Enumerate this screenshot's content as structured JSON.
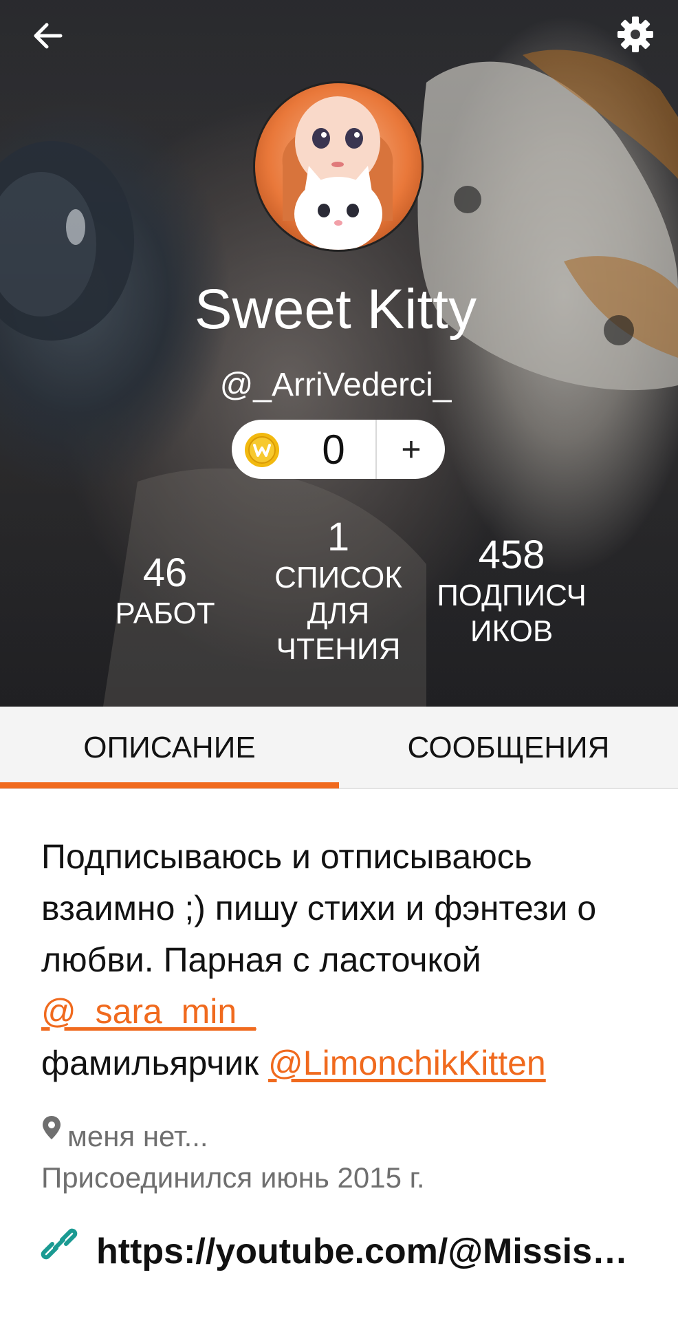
{
  "profile": {
    "name": "Sweet Kitty",
    "username": "@_ArriVederci_",
    "coins": "0",
    "add_coins_label": "+"
  },
  "stats": [
    {
      "value": "46",
      "label": "РАБОТ"
    },
    {
      "value": "1",
      "label_lines": [
        "СПИСОК",
        "ДЛЯ",
        "ЧТЕНИЯ"
      ]
    },
    {
      "value": "458",
      "label_lines": [
        "ПОДПИСЧ",
        "ИКОВ"
      ]
    }
  ],
  "tabs": [
    {
      "label": "ОПИСАНИЕ",
      "active": true
    },
    {
      "label": "СООБЩЕНИЯ",
      "active": false
    }
  ],
  "about": {
    "bio_text_1": "Подписываюсь и отписываюсь взаимно ;) пишу стихи и фэнтези о любви. Парная с ласточкой",
    "mention_1": "@_sara_min_",
    "bio_text_2": "фамильярчик",
    "mention_2": "@LimonchikKitten",
    "location": "меня нет...",
    "joined": "Присоединился июнь 2015 г.",
    "website": "https://youtube.com/@Missis_…"
  },
  "colors": {
    "accent": "#f06a1e",
    "link_icon": "#1a9a92",
    "coin": "#f2b90f"
  },
  "icons": [
    "back-arrow-icon",
    "gear-icon",
    "coin-icon",
    "location-pin-icon",
    "link-icon"
  ]
}
